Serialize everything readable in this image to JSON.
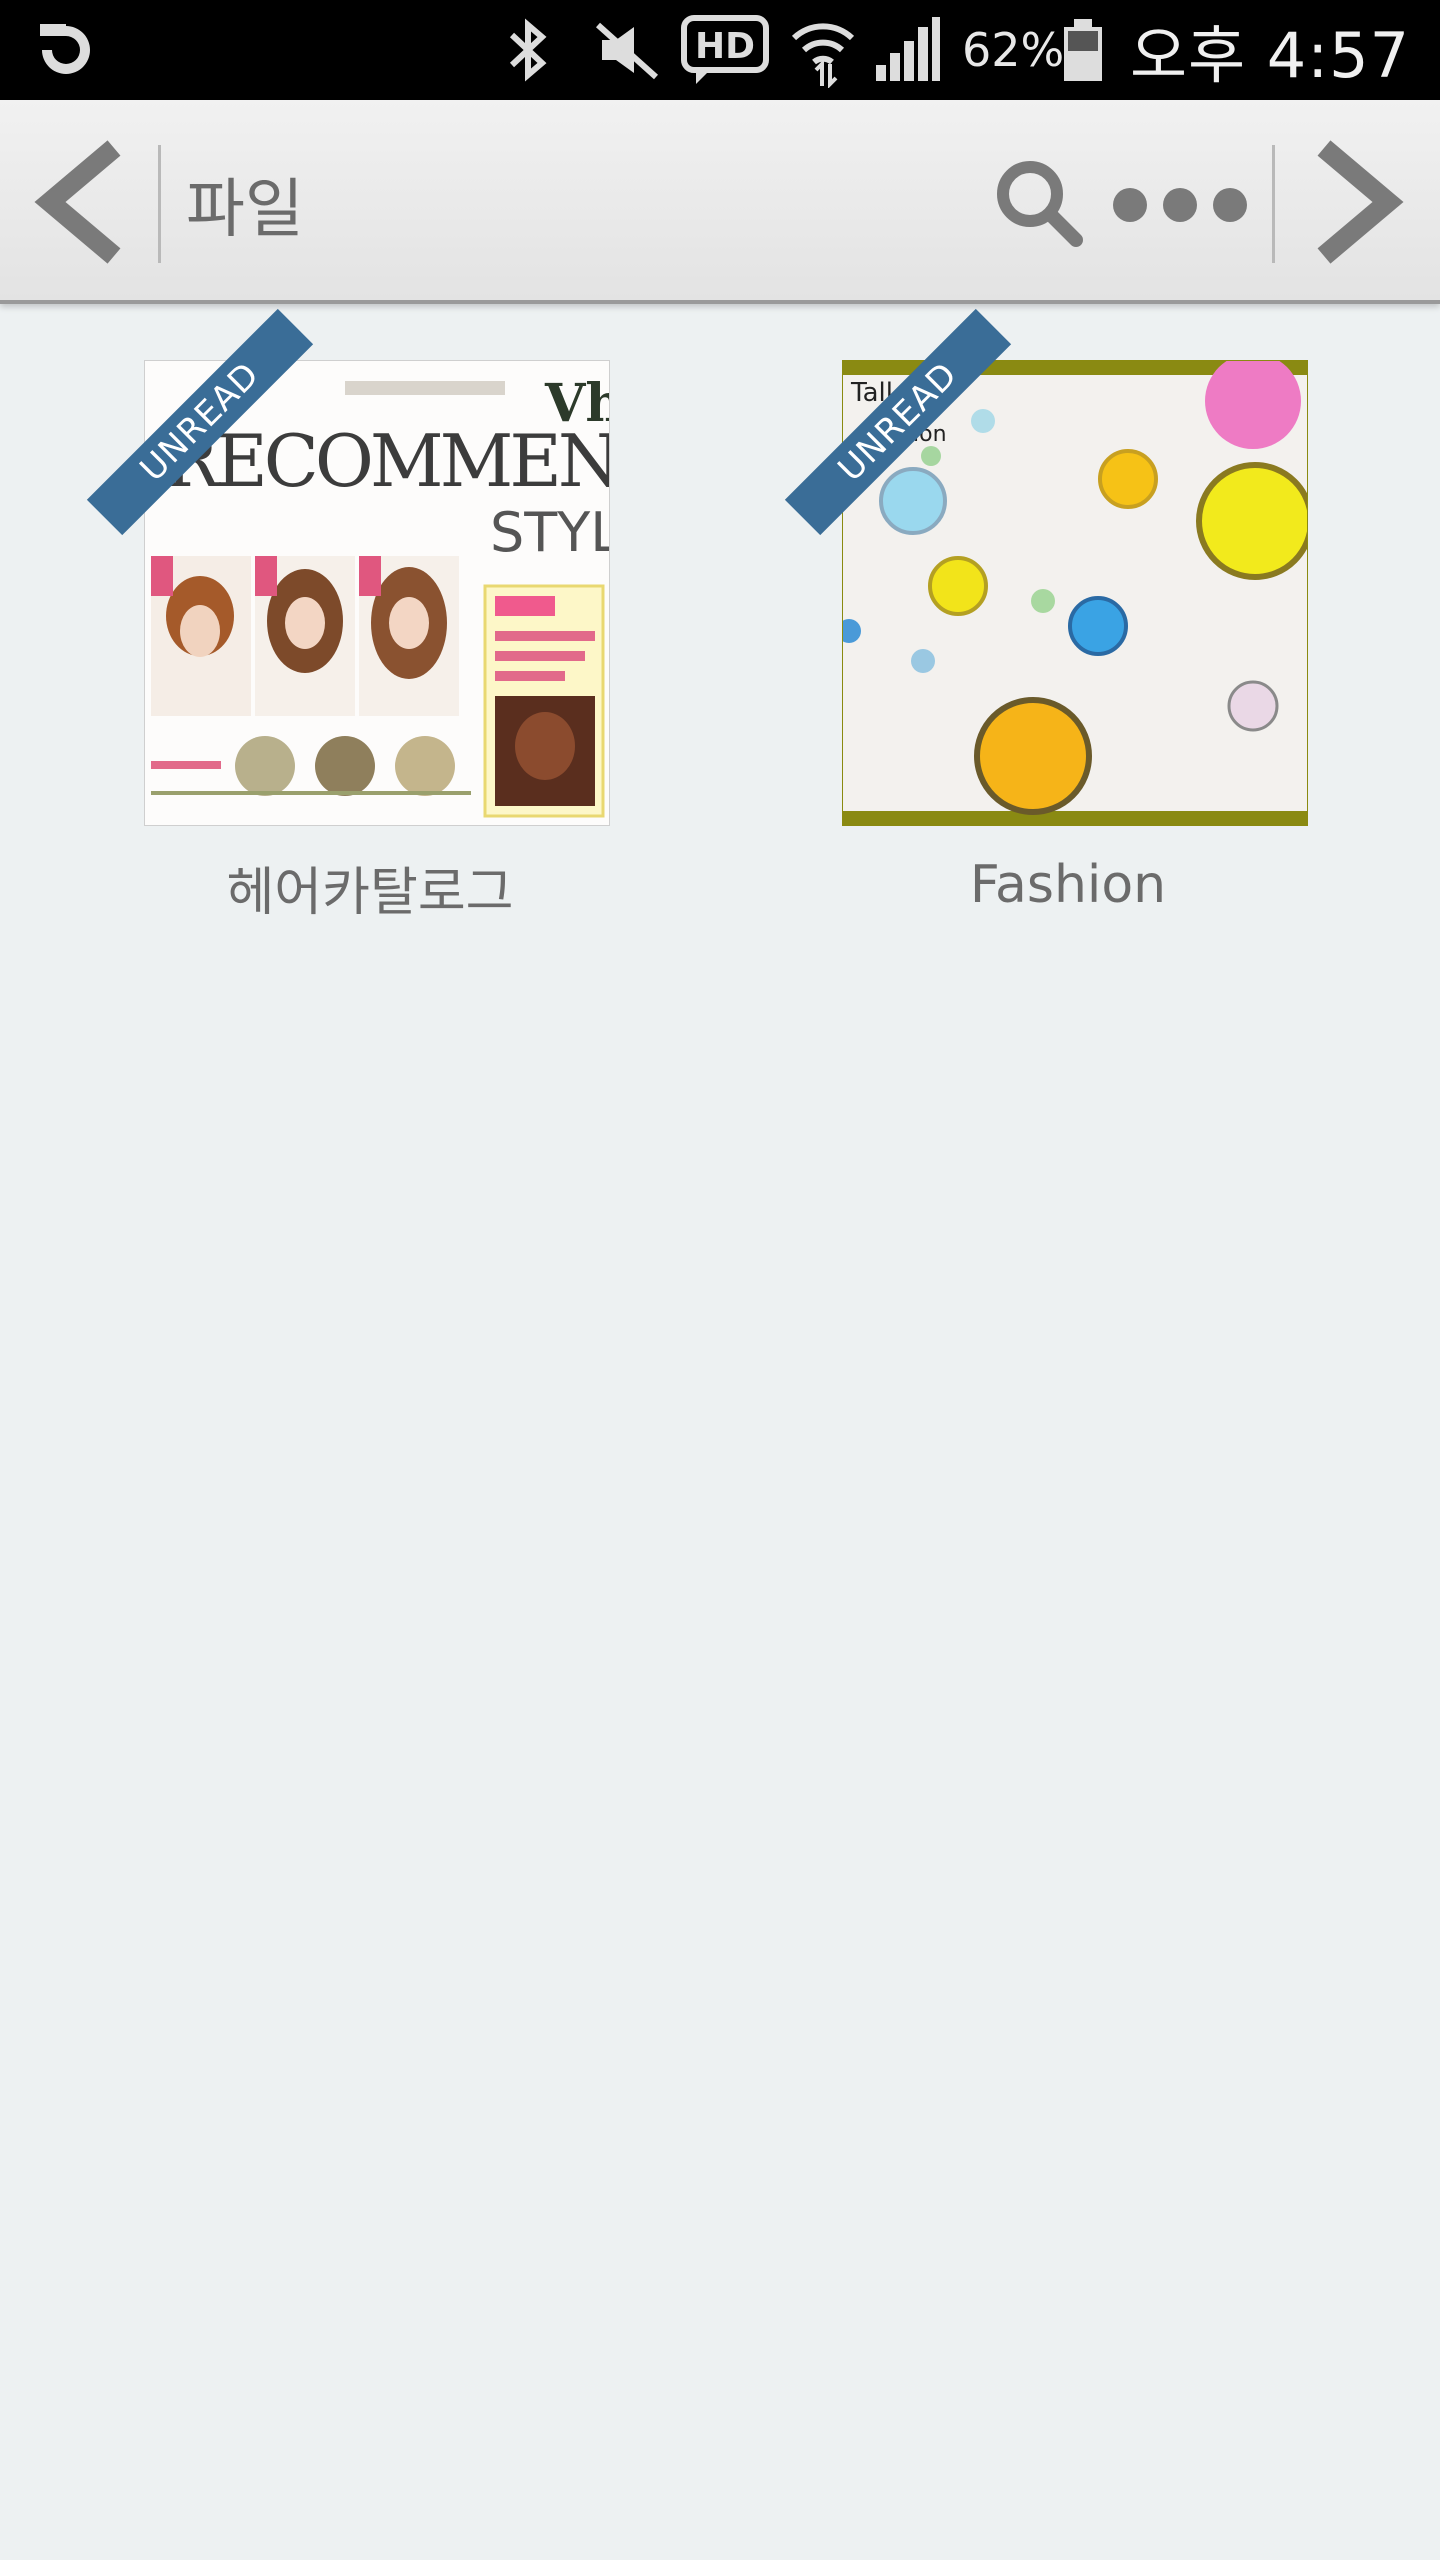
{
  "status_bar": {
    "carrier_icon": "olleh-logo-icon",
    "battery_percent": "62%",
    "time": "오후 4:57",
    "icons": [
      "bluetooth-icon",
      "mute-icon",
      "hd-voice-icon",
      "wifi-icon",
      "signal-icon",
      "battery-icon"
    ]
  },
  "app_bar": {
    "title": "파일",
    "back_icon": "chevron-left-icon",
    "search_icon": "search-icon",
    "more_icon": "more-dots-icon",
    "forward_icon": "chevron-right-icon"
  },
  "files": [
    {
      "name": "헤어카탈로그",
      "badge": "UNREAD",
      "thumb_text": "RECOMMEND",
      "thumb_subtext": "STYLE"
    },
    {
      "name": "Fashion",
      "badge": "UNREAD"
    }
  ],
  "colors": {
    "background": "#edf1f2",
    "ribbon": "#3a6d97",
    "app_bar": "#ebebeb",
    "text": "#6b6b6b"
  }
}
